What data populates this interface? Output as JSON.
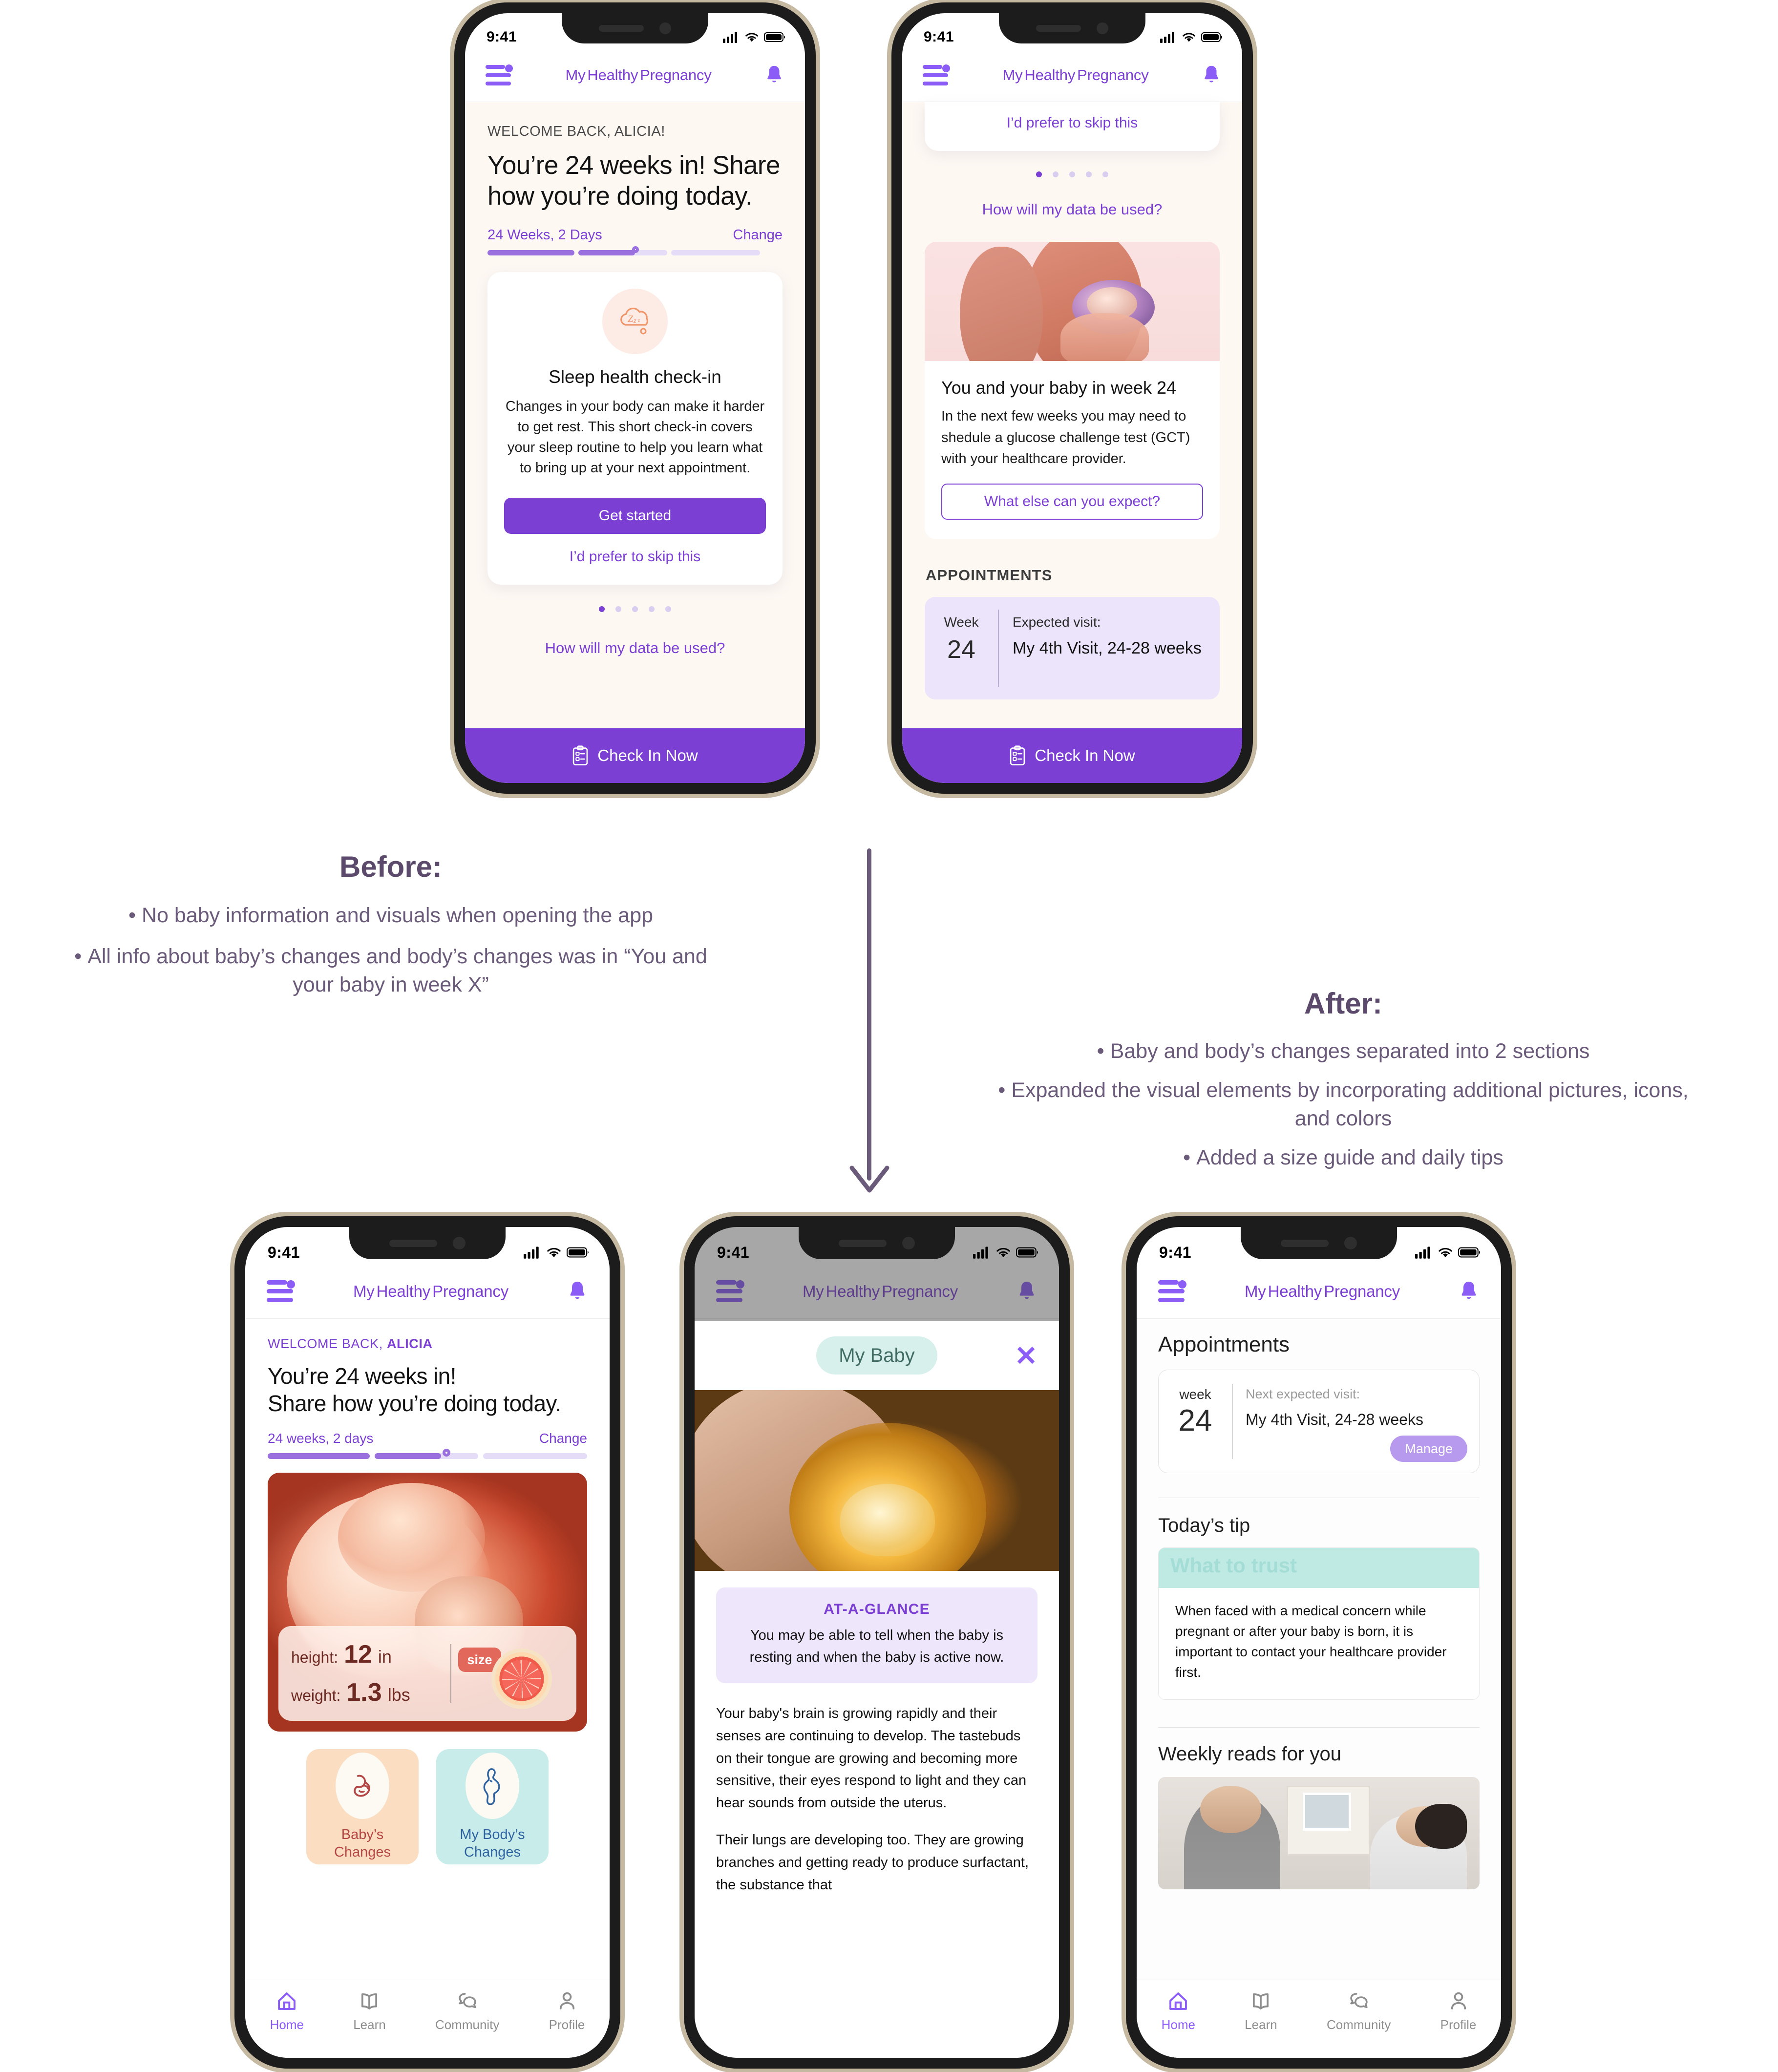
{
  "app": {
    "brand_part1": "My",
    "brand_part2": "Healthy",
    "brand_part3": "Pregnancy",
    "status_time": "9:41"
  },
  "before_phone1": {
    "welcome": "WELCOME BACK, ALICIA!",
    "headline": "You’re 24 weeks in! Share how you’re doing today.",
    "progress_label": "24 Weeks, 2 Days",
    "change_label": "Change",
    "card": {
      "icon": "sleep-cloud-icon",
      "title": "Sleep health check-in",
      "body": "Changes in your body can make it harder to get rest. This short check-in covers your sleep routine to help you learn what to bring up at your next appointment.",
      "cta": "Get started",
      "skip": "I’d prefer to skip this"
    },
    "dots_total": 5,
    "dots_active": 1,
    "data_link": "How will my data be used?",
    "checkin": "Check In Now"
  },
  "before_phone2": {
    "skip": "I’d prefer to skip this",
    "dots_total": 5,
    "dots_active": 1,
    "data_link": "How will my data be used?",
    "info_title": "You and your baby in week 24",
    "info_body": "In the next few weeks you may need to shedule a glucose challenge test (GCT) with your healthcare provider.",
    "info_button": "What else can you expect?",
    "appointments_label": "APPOINTMENTS",
    "appt_week_label": "Week",
    "appt_week_number": "24",
    "appt_expected_label": "Expected visit:",
    "appt_visit": "My 4th Visit, 24-28 weeks",
    "checkin": "Check In Now"
  },
  "annotations": {
    "before": {
      "title": "Before:",
      "bullets": [
        "No baby information and visuals when opening the app",
        "All info about baby’s changes and body’s changes was in “You and your baby in week X”"
      ]
    },
    "after": {
      "title": "After:",
      "bullets": [
        "Baby and body’s changes separated into 2 sections",
        "Expanded the visual elements by incorporating additional pictures, icons, and colors",
        "Added a size guide and daily tips"
      ]
    }
  },
  "after_home": {
    "welcome_prefix": "WELCOME BACK, ",
    "welcome_name": "ALICIA",
    "headline_line1": "You’re 24 weeks in!",
    "headline_line2": "Share how you’re doing today.",
    "progress_label": "24 weeks, 2 days",
    "change_label": "Change",
    "size_guide": {
      "height_label": "height:",
      "height_value": "12",
      "height_unit": "in",
      "weight_label": "weight:",
      "weight_value": "1.3",
      "weight_unit": "lbs",
      "badge": "size",
      "fruit_icon": "grapefruit-icon"
    },
    "tiles": [
      {
        "icon": "fetus-icon",
        "line1": "Baby’s",
        "line2": "Changes",
        "color": "#fbddc1"
      },
      {
        "icon": "pregnant-body-icon",
        "line1": "My Body’s",
        "line2": "Changes",
        "color": "#c8ecea"
      }
    ],
    "tabs": [
      {
        "icon": "home-icon",
        "label": "Home",
        "active": true
      },
      {
        "icon": "book-icon",
        "label": "Learn",
        "active": false
      },
      {
        "icon": "chat-icon",
        "label": "Community",
        "active": false
      },
      {
        "icon": "person-icon",
        "label": "Profile",
        "active": false
      }
    ]
  },
  "after_baby": {
    "chip": "My Baby",
    "close_icon": "close-icon",
    "glance_title": "AT-A-GLANCE",
    "glance_text": "You may be able to tell when the baby is resting and when the baby is active now.",
    "paragraph1": "Your baby's brain is growing rapidly and their senses are continuing to develop. The tastebuds on their tongue are growing and becoming more sensitive, their eyes respond to light and they can hear sounds from outside the uterus.",
    "paragraph2": "Their lungs are developing too. They are growing branches and getting ready to produce surfactant, the substance that"
  },
  "after_appointments": {
    "page_title": "Appointments",
    "appt_week_label": "week",
    "appt_week_number": "24",
    "appt_expected_label": "Next expected visit:",
    "appt_visit": "My 4th Visit, 24-28 weeks",
    "manage_label": "Manage",
    "tip_section_title": "Today’s tip",
    "tip_title": "What to trust",
    "tip_body": "When faced with a medical concern while pregnant or after your baby is born, it is important to contact your healthcare provider first.",
    "reads_title": "Weekly reads for you",
    "tabs": [
      {
        "icon": "home-icon",
        "label": "Home",
        "active": true
      },
      {
        "icon": "book-icon",
        "label": "Learn",
        "active": false
      },
      {
        "icon": "chat-icon",
        "label": "Community",
        "active": false
      },
      {
        "icon": "person-icon",
        "label": "Profile",
        "active": false
      }
    ]
  },
  "colors": {
    "brand_purple": "#7b3fd4",
    "accent_purple": "#8b5cf6",
    "cream": "#fdf8f2",
    "orange_tile": "#fbddc1",
    "mint_tile": "#c8ecea",
    "annotation": "#6b5b7a"
  }
}
